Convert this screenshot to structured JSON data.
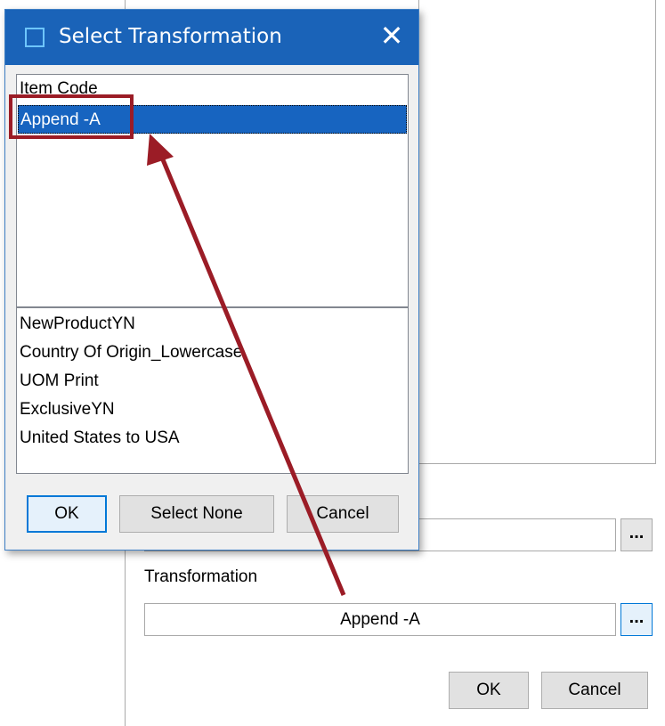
{
  "dialog": {
    "title": "Select Transformation",
    "top_list": {
      "header": "Item Code",
      "selected_item": "Append -A"
    },
    "bottom_list": {
      "items": [
        "NewProductYN",
        "Country Of Origin_Lowercase",
        "UOM Print",
        "ExclusiveYN",
        "United States to USA"
      ]
    },
    "buttons": {
      "ok": "OK",
      "select_none": "Select None",
      "cancel": "Cancel"
    }
  },
  "background_form": {
    "ellipsis_label": "...",
    "transformation_label": "Transformation",
    "transformation_value": "Append -A",
    "ok": "OK",
    "cancel": "Cancel"
  },
  "colors": {
    "titlebar": "#1a63b8",
    "selection": "#1764c0",
    "annotation": "#9b1c26",
    "focus_border": "#0078d7"
  }
}
